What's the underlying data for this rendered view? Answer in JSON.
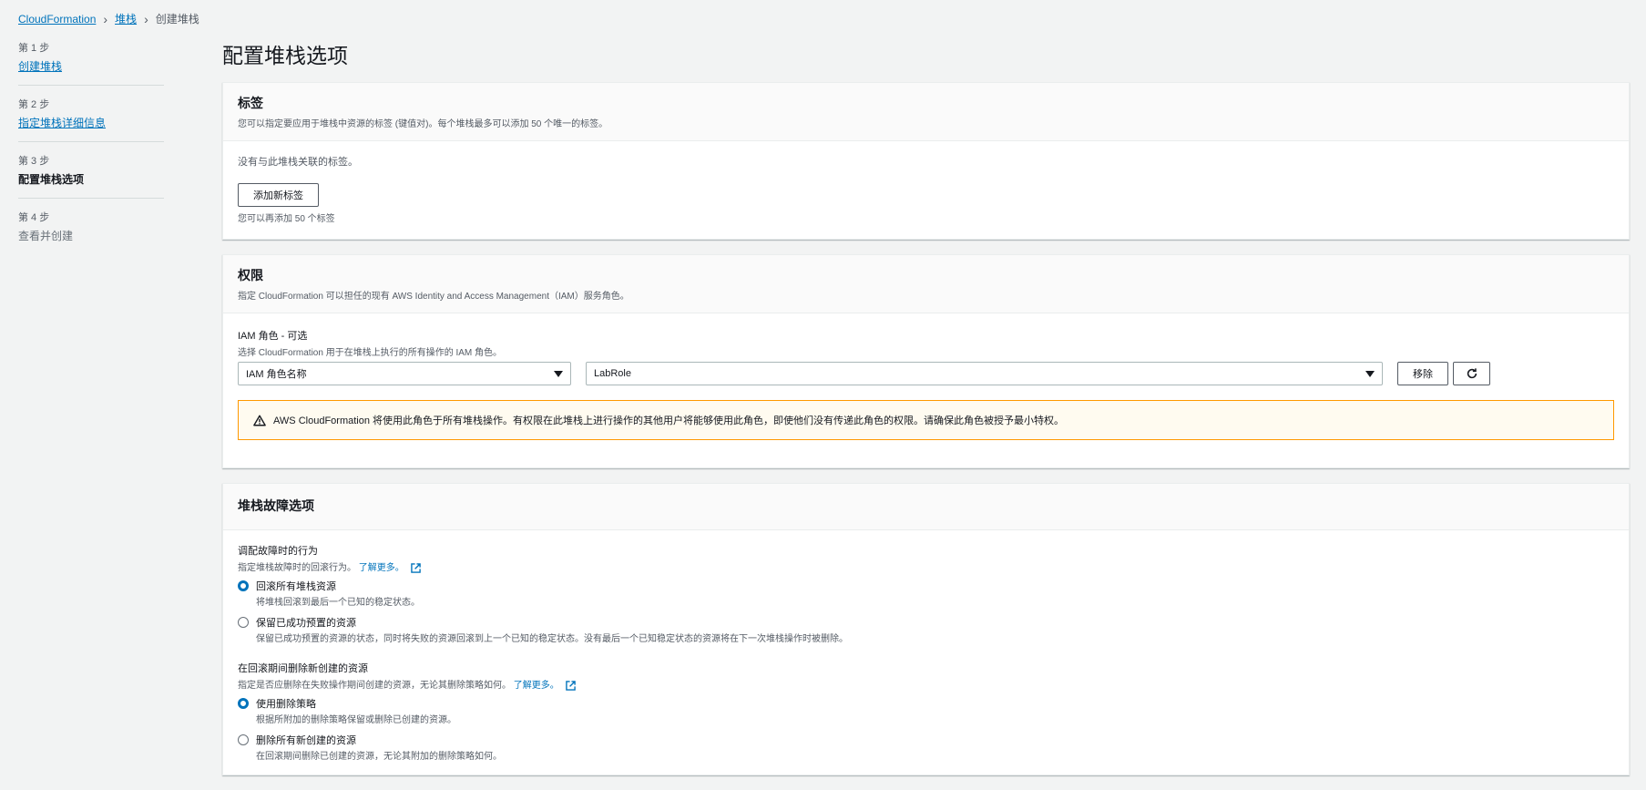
{
  "breadcrumb": {
    "items": [
      "CloudFormation",
      "堆栈"
    ],
    "current": "创建堆栈"
  },
  "steps": [
    {
      "num": "第 1 步",
      "label": "创建堆栈"
    },
    {
      "num": "第 2 步",
      "label": "指定堆栈详细信息"
    },
    {
      "num": "第 3 步",
      "label": "配置堆栈选项"
    },
    {
      "num": "第 4 步",
      "label": "查看并创建"
    }
  ],
  "page_title": "配置堆栈选项",
  "tags": {
    "title": "标签",
    "description": "您可以指定要应用于堆栈中资源的标签 (键值对)。每个堆栈最多可以添加 50 个唯一的标签。",
    "empty": "没有与此堆栈关联的标签。",
    "add_button": "添加新标签",
    "hint": "您可以再添加 50 个标签"
  },
  "permissions": {
    "title": "权限",
    "description": "指定 CloudFormation 可以担任的现有 AWS Identity and Access Management（IAM）服务角色。",
    "field_label": "IAM 角色 - 可选",
    "field_desc": "选择 CloudFormation 用于在堆栈上执行的所有操作的 IAM 角色。",
    "select_type": "IAM 角色名称",
    "select_role": "LabRole",
    "remove_button": "移除",
    "alert": "AWS CloudFormation 将使用此角色于所有堆栈操作。有权限在此堆栈上进行操作的其他用户将能够使用此角色，即使他们没有传递此角色的权限。请确保此角色被授予最小特权。"
  },
  "failure": {
    "title": "堆栈故障选项",
    "group1": {
      "title": "调配故障时的行为",
      "desc": "指定堆栈故障时的回滚行为。",
      "learn": "了解更多。",
      "options": [
        {
          "label": "回滚所有堆栈资源",
          "desc": "将堆栈回滚到最后一个已知的稳定状态。",
          "checked": true
        },
        {
          "label": "保留已成功预置的资源",
          "desc": "保留已成功预置的资源的状态，同时将失败的资源回滚到上一个已知的稳定状态。没有最后一个已知稳定状态的资源将在下一次堆栈操作时被删除。",
          "checked": false
        }
      ]
    },
    "group2": {
      "title": "在回滚期间删除新创建的资源",
      "desc": "指定是否应删除在失败操作期间创建的资源，无论其删除策略如何。",
      "learn": "了解更多。",
      "options": [
        {
          "label": "使用删除策略",
          "desc": "根据所附加的删除策略保留或删除已创建的资源。",
          "checked": true
        },
        {
          "label": "删除所有新创建的资源",
          "desc": "在回滚期间删除已创建的资源，无论其附加的删除策略如何。",
          "checked": false
        }
      ]
    }
  },
  "colors": {
    "link": "#0073bb",
    "warning": "#ff9900",
    "background": "#f2f3f3"
  }
}
